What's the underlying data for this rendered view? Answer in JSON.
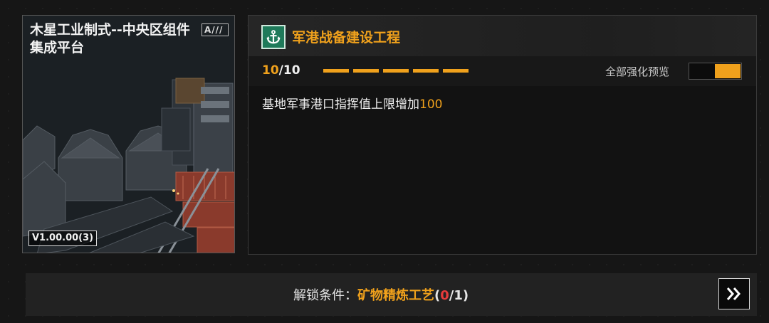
{
  "card": {
    "title": "木星工业制式--中央区组件集成平台",
    "grade_badge": "A///",
    "version": "V1.00.00(3)"
  },
  "project": {
    "title": "军港战备建设工程",
    "icon": "anchor-icon",
    "level_current": "10",
    "level_sep_max": "/10",
    "segments_total": 5,
    "segments_filled": 5,
    "preview_label": "全部强化预览",
    "effect_prefix": "基地军事港口指挥值上限增加",
    "effect_value": "100"
  },
  "unlock": {
    "label": "解锁条件：",
    "requirement": "矿物精炼工艺",
    "open_paren": "(",
    "have": "0",
    "need_close": "/1)"
  },
  "colors": {
    "accent": "#f0a11c",
    "badge_green": "#1f7a5a",
    "warn_red": "#e53b3b"
  }
}
